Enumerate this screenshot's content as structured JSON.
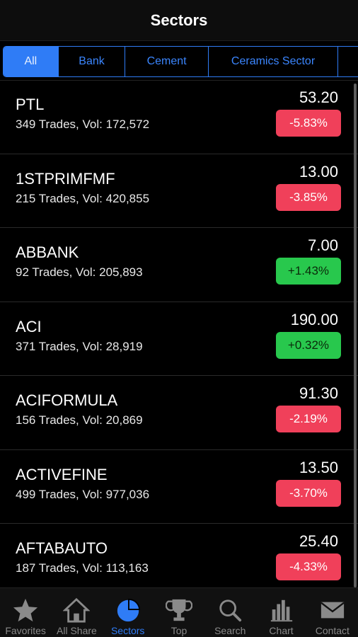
{
  "header": {
    "title": "Sectors"
  },
  "segments": [
    "All",
    "Bank",
    "Cement",
    "Ceramics Sector",
    ""
  ],
  "rows": [
    {
      "symbol": "PTL",
      "meta": "349 Trades, Vol: 172,572",
      "price": "53.20",
      "change": "-5.83%",
      "direction": "down"
    },
    {
      "symbol": "1STPRIMFMF",
      "meta": "215 Trades, Vol: 420,855",
      "price": "13.00",
      "change": "-3.85%",
      "direction": "down"
    },
    {
      "symbol": "ABBANK",
      "meta": "92 Trades, Vol: 205,893",
      "price": "7.00",
      "change": "+1.43%",
      "direction": "up"
    },
    {
      "symbol": "ACI",
      "meta": "371 Trades, Vol: 28,919",
      "price": "190.00",
      "change": "+0.32%",
      "direction": "up"
    },
    {
      "symbol": "ACIFORMULA",
      "meta": "156 Trades, Vol: 20,869",
      "price": "91.30",
      "change": "-2.19%",
      "direction": "down"
    },
    {
      "symbol": "ACTIVEFINE",
      "meta": "499 Trades, Vol: 977,036",
      "price": "13.50",
      "change": "-3.70%",
      "direction": "down"
    },
    {
      "symbol": "AFTABAUTO",
      "meta": "187 Trades, Vol: 113,163",
      "price": "25.40",
      "change": "-4.33%",
      "direction": "down"
    }
  ],
  "tabs": [
    {
      "label": "Favorites",
      "icon": "star-icon"
    },
    {
      "label": "All Share",
      "icon": "home-icon"
    },
    {
      "label": "Sectors",
      "icon": "pie-chart-icon"
    },
    {
      "label": "Top",
      "icon": "trophy-icon"
    },
    {
      "label": "Search",
      "icon": "search-icon"
    },
    {
      "label": "Chart",
      "icon": "bar-chart-icon"
    },
    {
      "label": "Contact",
      "icon": "mail-icon"
    }
  ],
  "colors": {
    "accent": "#2f7cf6",
    "down": "#f0405a",
    "up": "#28c84d"
  }
}
